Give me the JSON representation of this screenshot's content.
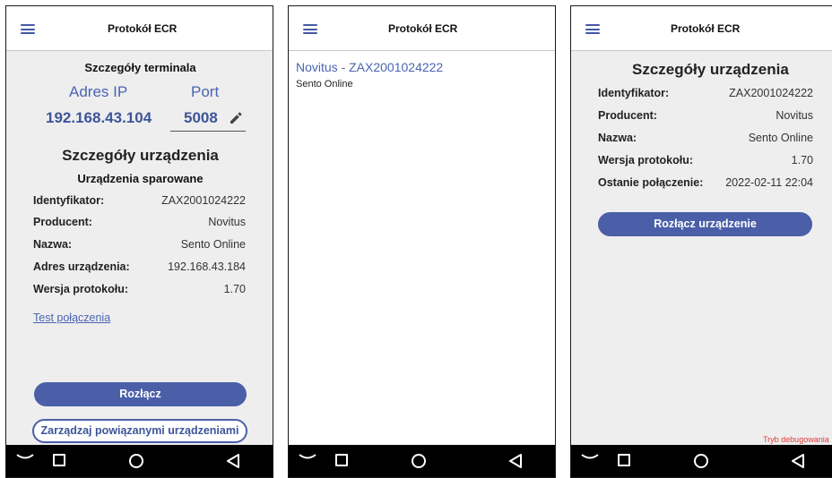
{
  "app": {
    "title": "Protokół ECR"
  },
  "screen1": {
    "terminal_header": "Szczegóły terminala",
    "ip_label": "Adres IP",
    "port_label": "Port",
    "ip_value": "192.168.43.104",
    "port_value": "5008",
    "device_header": "Szczegóły urządzenia",
    "paired_header": "Urządzenia sparowane",
    "rows": [
      {
        "label": "Identyfikator:",
        "value": "ZAX2001024222"
      },
      {
        "label": "Producent:",
        "value": "Novitus"
      },
      {
        "label": "Nazwa:",
        "value": "Sento Online"
      },
      {
        "label": "Adres urządzenia:",
        "value": "192.168.43.184"
      },
      {
        "label": "Wersja protokołu:",
        "value": "1.70"
      }
    ],
    "test_link": "Test połączenia",
    "disconnect_button": "Rozłącz",
    "manage_button": "Zarządzaj powiązanymi urządzeniami"
  },
  "screen2": {
    "device_title": "Novitus - ZAX2001024222",
    "device_subtitle": "Sento Online"
  },
  "screen3": {
    "device_header": "Szczegóły urządzenia",
    "rows": [
      {
        "label": "Identyfikator:",
        "value": "ZAX2001024222"
      },
      {
        "label": "Producent:",
        "value": "Novitus"
      },
      {
        "label": "Nazwa:",
        "value": "Sento Online"
      },
      {
        "label": "Wersja protokołu:",
        "value": "1.70"
      },
      {
        "label": "Ostanie połączenie:",
        "value": "2022-02-11 22:04"
      }
    ],
    "disconnect_button": "Rozłącz urządzenie",
    "debug_mode": "Tryb debugowania"
  },
  "icons": {
    "menu": "hamburger-menu-icon",
    "edit": "pencil-icon",
    "nav_back": "nav-back-icon",
    "nav_overview": "square-icon",
    "nav_home": "circle-icon",
    "nav_previous": "triangle-back-icon"
  },
  "colors": {
    "accent": "#4a5fa8",
    "link": "#4a64b3",
    "debug": "#e03a3a",
    "screen_background": "#eeeeee"
  }
}
